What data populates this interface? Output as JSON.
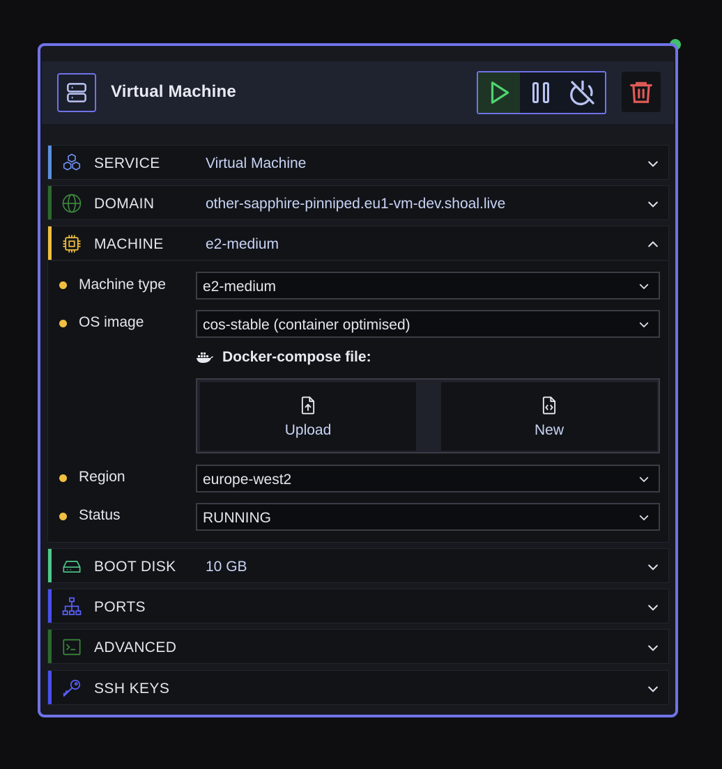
{
  "header": {
    "title": "Virtual Machine"
  },
  "colors": {
    "accent": "#6f73e8",
    "running": "#3fbf6c",
    "delete": "#e05a55",
    "warning": "#f1bf3f"
  },
  "sections": {
    "service": {
      "label": "SERVICE",
      "value": "Virtual Machine",
      "icon": "cubes-icon",
      "color": "#5b8fe0"
    },
    "domain": {
      "label": "DOMAIN",
      "value": "other-sapphire-pinniped.eu1-vm-dev.shoal.live",
      "icon": "globe-icon",
      "color": "#2f6a2f"
    },
    "machine": {
      "label": "MACHINE",
      "value": "e2-medium",
      "icon": "cpu-icon",
      "color": "#f1bf3f"
    },
    "boot_disk": {
      "label": "BOOT DISK",
      "value": "10 GB",
      "icon": "hard-drive-icon",
      "color": "#4fc98a"
    },
    "ports": {
      "label": "PORTS",
      "icon": "network-icon",
      "color": "#4a4ff0"
    },
    "advanced": {
      "label": "ADVANCED",
      "icon": "terminal-icon",
      "color": "#2f6a2f"
    },
    "ssh_keys": {
      "label": "SSH KEYS",
      "icon": "key-icon",
      "color": "#4a4ff0"
    }
  },
  "machine_panel": {
    "machine_type": {
      "label": "Machine type",
      "value": "e2-medium"
    },
    "os_image": {
      "label": "OS image",
      "value": "cos-stable (container optimised)"
    },
    "docker_compose": {
      "label": "Docker-compose file:",
      "upload": "Upload",
      "new": "New"
    },
    "region": {
      "label": "Region",
      "value": "europe-west2"
    },
    "status": {
      "label": "Status",
      "value": "RUNNING"
    }
  }
}
